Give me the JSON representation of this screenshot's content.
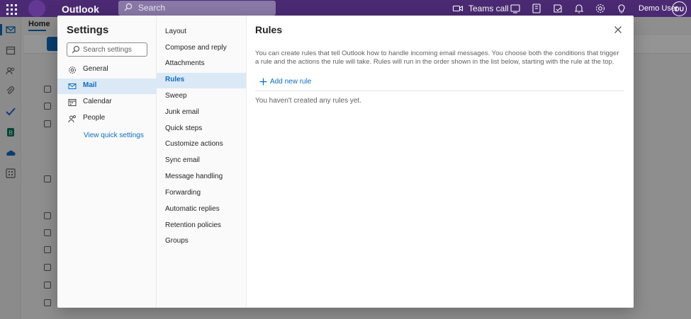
{
  "topbar": {
    "app_title": "Outlook",
    "search_placeholder": "Search",
    "teams_call_label": "Teams call",
    "user_name": "Demo User",
    "user_initials": "DU"
  },
  "background": {
    "ribbon_tab": "Home"
  },
  "settings": {
    "title": "Settings",
    "search_placeholder": "Search settings",
    "categories": [
      {
        "label": "General",
        "icon": "gear-icon"
      },
      {
        "label": "Mail",
        "icon": "mail-icon",
        "selected": true
      },
      {
        "label": "Calendar",
        "icon": "calendar-icon"
      },
      {
        "label": "People",
        "icon": "people-icon"
      }
    ],
    "quick_settings_link": "View quick settings",
    "mail_subcategories": [
      {
        "label": "Layout"
      },
      {
        "label": "Compose and reply"
      },
      {
        "label": "Attachments"
      },
      {
        "label": "Rules",
        "selected": true
      },
      {
        "label": "Sweep"
      },
      {
        "label": "Junk email"
      },
      {
        "label": "Quick steps"
      },
      {
        "label": "Customize actions"
      },
      {
        "label": "Sync email"
      },
      {
        "label": "Message handling"
      },
      {
        "label": "Forwarding"
      },
      {
        "label": "Automatic replies"
      },
      {
        "label": "Retention policies"
      },
      {
        "label": "Groups"
      }
    ]
  },
  "rules": {
    "title": "Rules",
    "description": "You can create rules that tell Outlook how to handle incoming email messages. You choose both the conditions that trigger a rule and the actions the rule will take. Rules will run in the order shown in the list below, starting with the rule at the top.",
    "add_rule_label": "Add new rule",
    "empty_message": "You haven't created any rules yet."
  },
  "colors": {
    "topbar": "#4b2a73",
    "accent": "#0f6cbd",
    "selected_bg": "#dbe9f7"
  }
}
